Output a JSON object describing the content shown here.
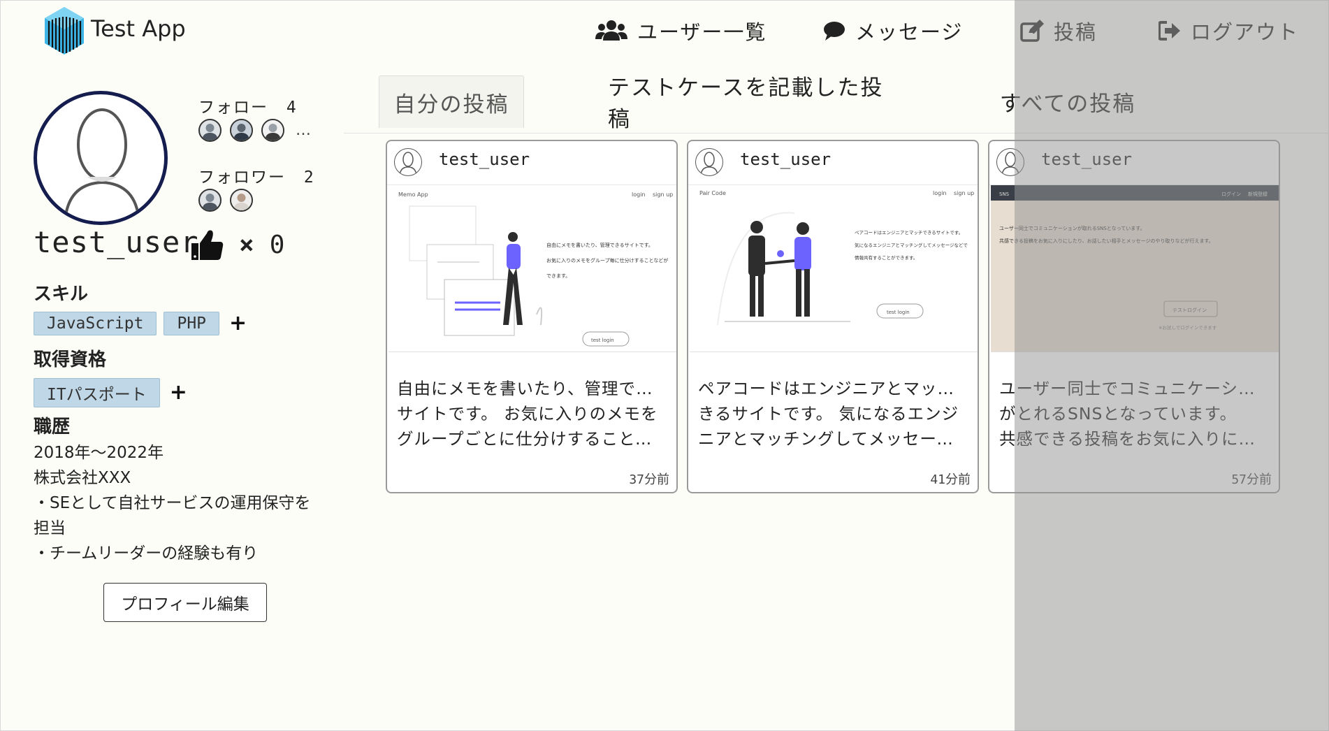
{
  "header": {
    "app_title": "Test App",
    "nav": [
      {
        "label": "ユーザー一覧",
        "icon": "users-icon"
      },
      {
        "label": "メッセージ",
        "icon": "comment-icon"
      },
      {
        "label": "投稿",
        "icon": "edit-icon"
      },
      {
        "label": "ログアウト",
        "icon": "sign-out-icon"
      }
    ]
  },
  "profile": {
    "username": "test_user",
    "follow_label": "フォロー",
    "follow_count": "4",
    "follower_label": "フォロワー",
    "follower_count": "2",
    "more": "…",
    "likes_times": "×",
    "likes_count": "0",
    "skills_title": "スキル",
    "skills": [
      "JavaScript",
      "PHP"
    ],
    "plus": "+",
    "cert_title": "取得資格",
    "certs": [
      "ITパスポート"
    ],
    "career_title": "職歴",
    "career": [
      "2018年〜2022年",
      "株式会社XXX",
      "・SEとして自社サービスの運用保守を担当",
      "・チームリーダーの経験も有り"
    ],
    "edit_button": "プロフィール編集"
  },
  "tabs": [
    "自分の投稿",
    "テストケースを記載した投稿",
    "すべての投稿"
  ],
  "cards": [
    {
      "user": "test_user",
      "text": [
        "自由にメモを書いたり、管理できる",
        "サイトです。 お気に入りのメモを",
        "グループごとに仕分けすることな…"
      ],
      "time": "37分前",
      "thumb": {
        "brand": "Memo App",
        "nav1": "login",
        "nav2": "sign up",
        "lines": [
          "自由にメモを書いたり、管理できるサイトです。",
          "お気に入りのメモをグループ毎に仕分けすることなどが",
          "できます。"
        ],
        "button": "test login"
      }
    },
    {
      "user": "test_user",
      "text": [
        "ペアコードはエンジニアとマッチで",
        "きるサイトです。 気になるエンジ",
        "ニアとマッチングしてメッセージ…"
      ],
      "time": "41分前",
      "thumb": {
        "brand": "Pair Code",
        "nav1": "login",
        "nav2": "sign up",
        "lines": [
          "ペアコードはエンジニアとマッチできるサイトです。",
          "気になるエンジニアとマッチングしてメッセージなどで",
          "情報共有することができます。"
        ],
        "button": "test login"
      }
    },
    {
      "user": "test_user",
      "text": [
        "ユーザー同士でコミュニケーション",
        "がとれるSNSとなっています。",
        "共感できる投稿をお気に入りにし…"
      ],
      "time": "57分前",
      "thumb": {
        "brand": "SNS",
        "nav1": "ログイン",
        "nav2": "新規登録",
        "lines": [
          "ユーザー同士でコミュニケーションが取れるSNSとなっています。",
          "共感できる投稿をお気に入りにしたり、お話したい相手とメッセージのやり取りなどが行えます。"
        ],
        "button": "テストログイン",
        "note": "※お試しでログインできます"
      }
    }
  ],
  "colors": {
    "avatar_ring": "#141d4e",
    "tag_bg": "#bfd7e6",
    "accent_purple": "#6c63ff",
    "logo_blue": "#3db5e6"
  }
}
